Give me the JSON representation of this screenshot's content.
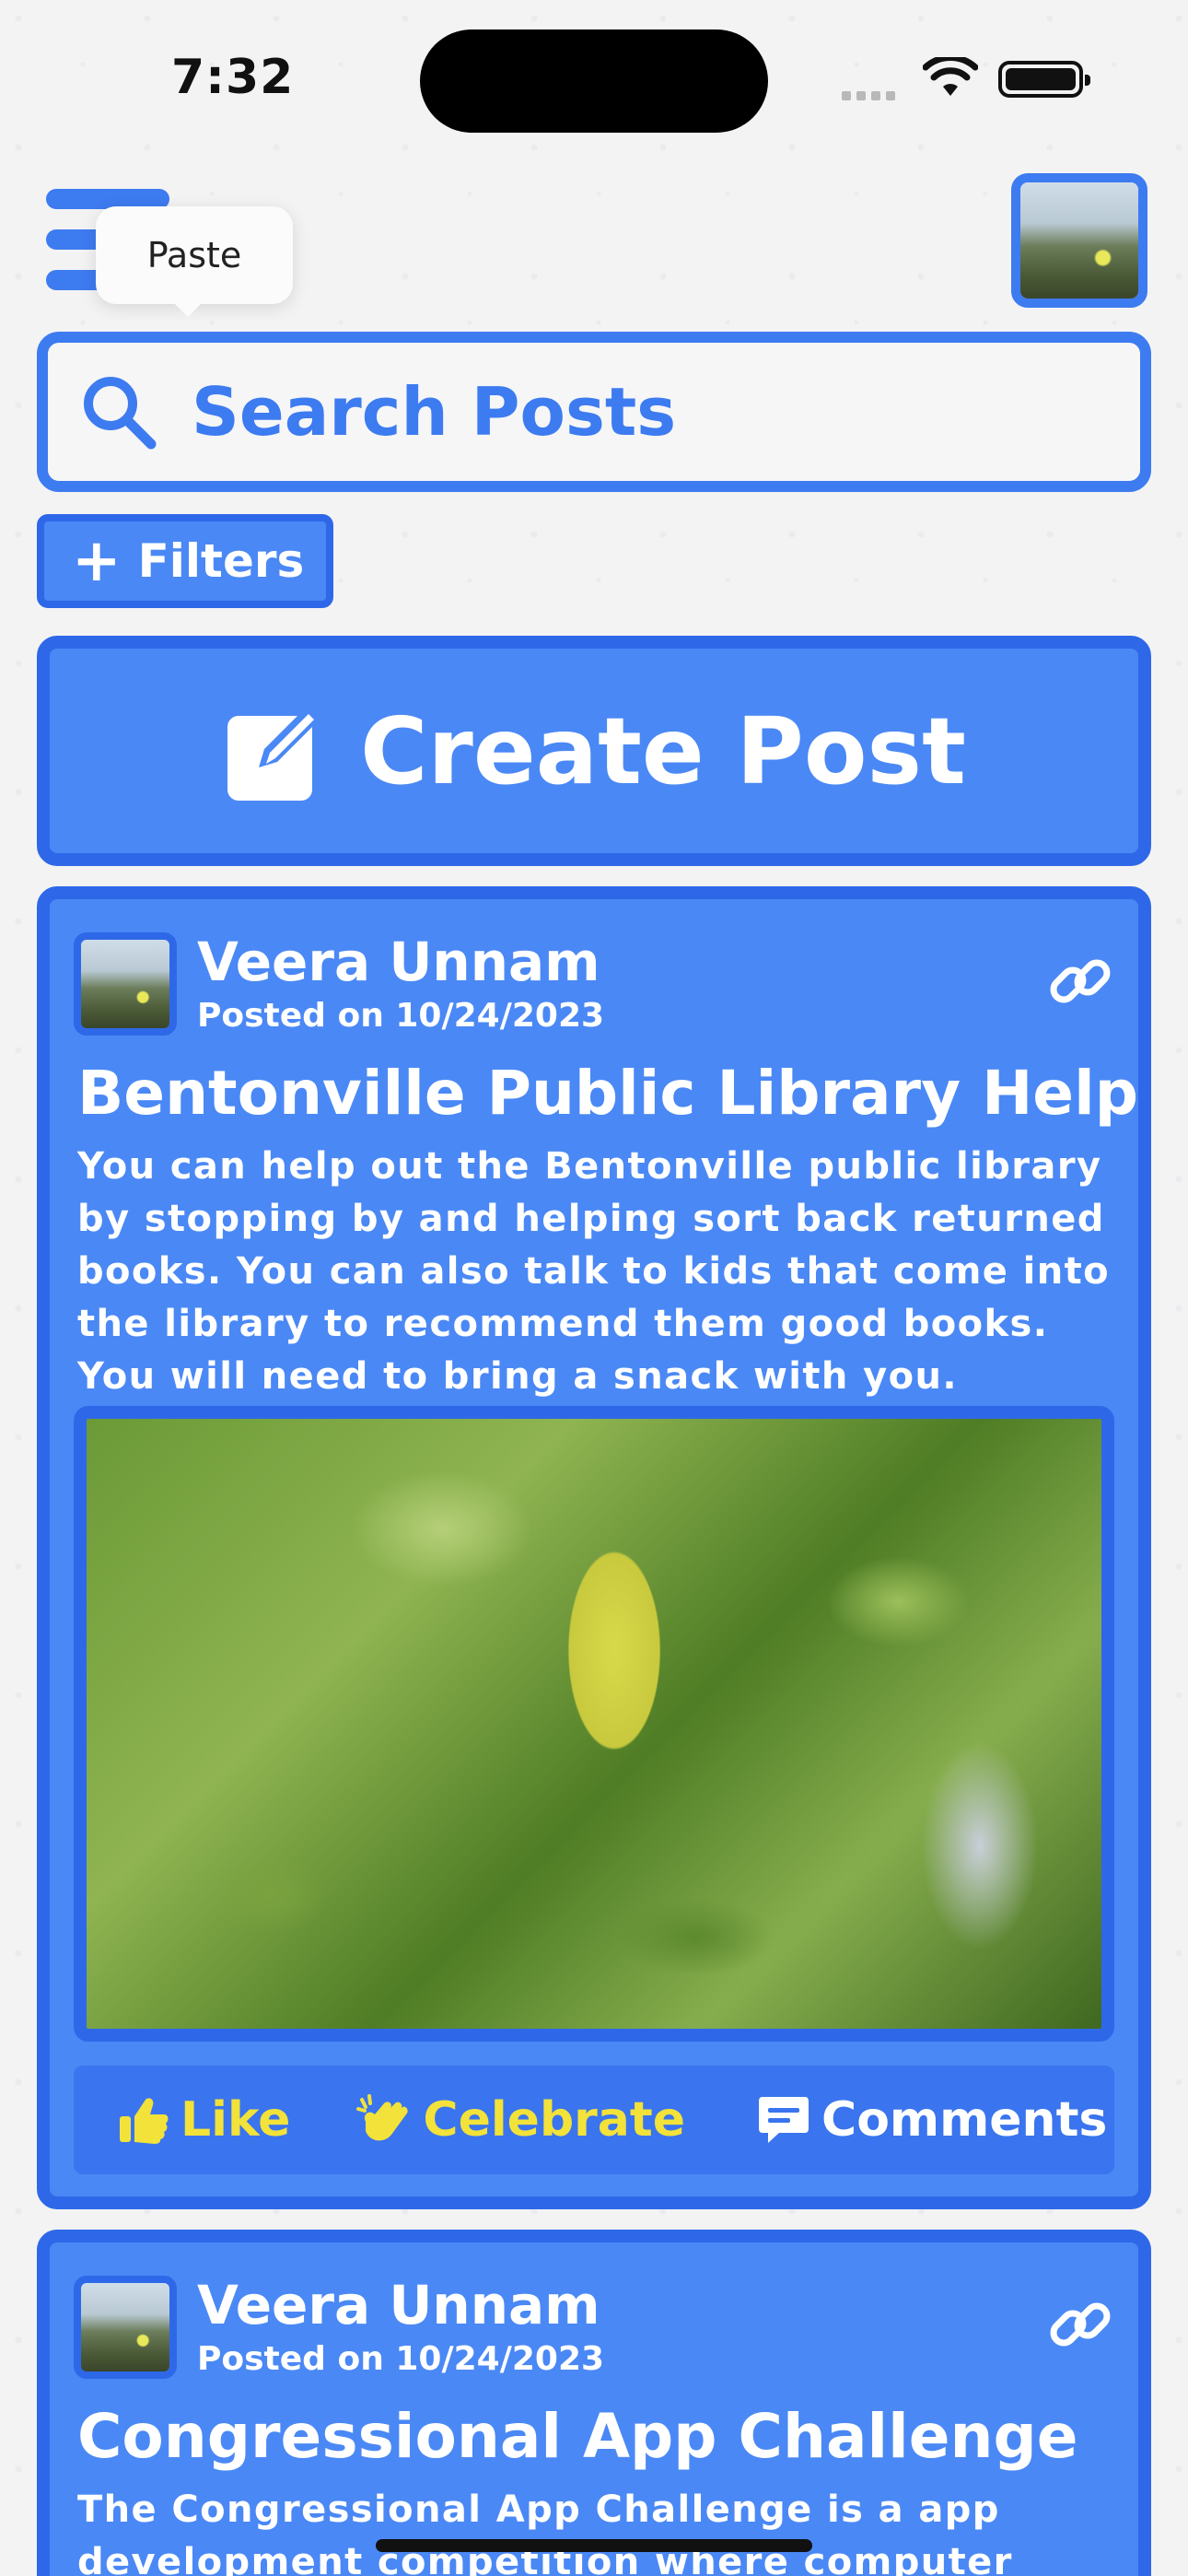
{
  "status_bar": {
    "time": "7:32"
  },
  "tooltip": {
    "label": "Paste"
  },
  "search": {
    "placeholder": "Search Posts"
  },
  "filters": {
    "label": "Filters"
  },
  "create_post": {
    "label": "Create Post"
  },
  "colors": {
    "primary": "#4a88f5",
    "border": "#2e68e8",
    "accent_yellow": "#f2e23a"
  },
  "posts": [
    {
      "author": "Veera Unnam",
      "posted": "Posted on 10/24/2023",
      "title": "Bentonville Public Library Helper",
      "body": "You can help out the Bentonville public library by stopping by and helping sort back returned books. You can also talk to kids that come into the library to recommend them good books. You will need to bring a snack with you.",
      "actions": {
        "like": "Like",
        "celebrate": "Celebrate",
        "comments": "Comments"
      }
    },
    {
      "author": "Veera Unnam",
      "posted": "Posted on 10/24/2023",
      "title": "Congressional App Challenge",
      "body": "The Congressional App Challenge is a app development competition where computer science"
    }
  ]
}
